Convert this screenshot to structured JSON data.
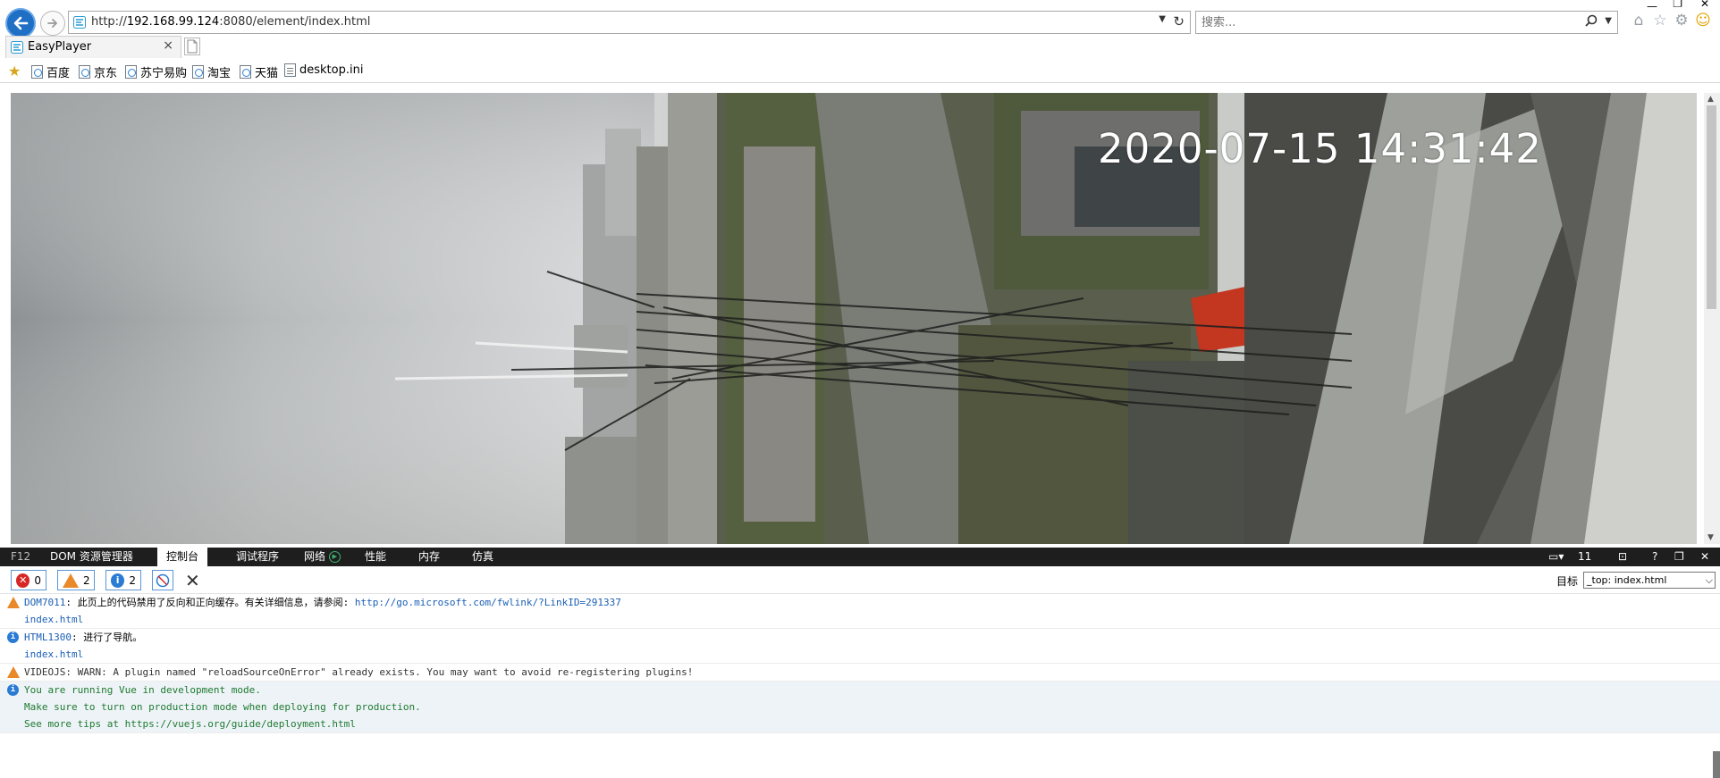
{
  "browser": {
    "url_prefix": "http://",
    "url_host": "192.168.99.124",
    "url_rest": ":8080/element/index.html",
    "search_placeholder": "搜索...",
    "tab_title": "EasyPlayer",
    "tab_close": "×",
    "icons": [
      "back-arrow-icon",
      "forward-arrow-icon",
      "refresh-icon",
      "search-icon",
      "home-icon",
      "star-icon",
      "gear-icon",
      "smiley-icon"
    ]
  },
  "favorites": [
    {
      "label": "百度"
    },
    {
      "label": "京东"
    },
    {
      "label": "苏宁易购"
    },
    {
      "label": "淘宝"
    },
    {
      "label": "天猫"
    },
    {
      "label": "desktop.ini"
    }
  ],
  "video": {
    "timestamp": "2020-07-15 14:31:42"
  },
  "devtools": {
    "f12": "F12",
    "tabs": [
      {
        "label": "DOM 资源管理器"
      },
      {
        "label": "控制台"
      },
      {
        "label": "调试程序"
      },
      {
        "label": "网络"
      },
      {
        "label": "性能"
      },
      {
        "label": "内存"
      },
      {
        "label": "仿真"
      }
    ],
    "active_tab": "控制台",
    "browser_mode_count": "11",
    "help": "?",
    "filters": {
      "errors": "0",
      "warnings": "2",
      "info": "2"
    },
    "target_label": "目标",
    "target_value": "_top: index.html"
  },
  "console": {
    "messages": [
      {
        "type": "warning",
        "code": "DOM7011",
        "text": ": 此页上的代码禁用了反向和正向缓存。有关详细信息，请参阅: ",
        "link": "http://go.microsoft.com/fwlink/?LinkID=291337",
        "source": "index.html"
      },
      {
        "type": "info",
        "code": "HTML1300",
        "text": ": 进行了导航。",
        "source": "index.html"
      },
      {
        "type": "warning",
        "text": "VIDEOJS: WARN: A plugin named \"reloadSourceOnError\" already exists. You may want to avoid re-registering plugins!"
      },
      {
        "type": "info",
        "lines": [
          "You are running Vue in development mode.",
          "Make sure to turn on production mode when deploying for production.",
          "See more tips at https://vuejs.org/guide/deployment.html"
        ]
      }
    ]
  },
  "colors": {
    "accent": "#1f6fc4",
    "devtools_bar": "#1e1e1e",
    "warning": "#e9892a",
    "info": "#2a7bd4",
    "error": "#d72626",
    "console_link": "#1a5fb4",
    "console_green": "#1d7a2e"
  }
}
